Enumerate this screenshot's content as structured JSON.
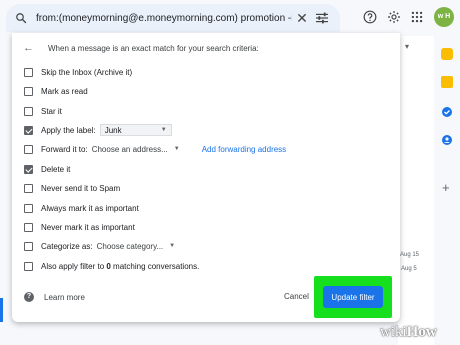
{
  "search": {
    "query": "from:(moneymorning@e.moneymorning.com) promotion -in:che",
    "clear_glyph": "✕"
  },
  "header_icons": [
    "help-icon",
    "settings-icon",
    "apps-icon",
    "avatar"
  ],
  "avatar": {
    "label": "w H"
  },
  "panel": {
    "heading": "When a message is an exact match for your search criteria:",
    "options": [
      {
        "label": "Skip the Inbox (Archive it)",
        "checked": false
      },
      {
        "label": "Mark as read",
        "checked": false
      },
      {
        "label": "Star it",
        "checked": false
      },
      {
        "label": "Apply the label:",
        "checked": true,
        "select_value": "Junk"
      },
      {
        "label": "Forward it to:",
        "checked": false,
        "select_value": "Choose an address...",
        "link": "Add forwarding address"
      },
      {
        "label": "Delete it",
        "checked": true
      },
      {
        "label": "Never send it to Spam",
        "checked": false
      },
      {
        "label": "Always mark it as important",
        "checked": false
      },
      {
        "label": "Never mark it as important",
        "checked": false
      },
      {
        "label": "Categorize as:",
        "checked": false,
        "select_value": "Choose category..."
      },
      {
        "label_pre": "Also apply filter to ",
        "label_count": "0",
        "label_post": " matching conversations.",
        "checked": false
      }
    ],
    "learn_more": "Learn more",
    "cancel": "Cancel",
    "update": "Update filter"
  },
  "background": {
    "list_caret": "▾",
    "time1": "Aug 15",
    "time2": "Aug 5"
  },
  "watermark": {
    "wiki": "wiki",
    "how": "How"
  },
  "colors": {
    "accent": "#1a73e8",
    "highlight": "#16e01e"
  }
}
